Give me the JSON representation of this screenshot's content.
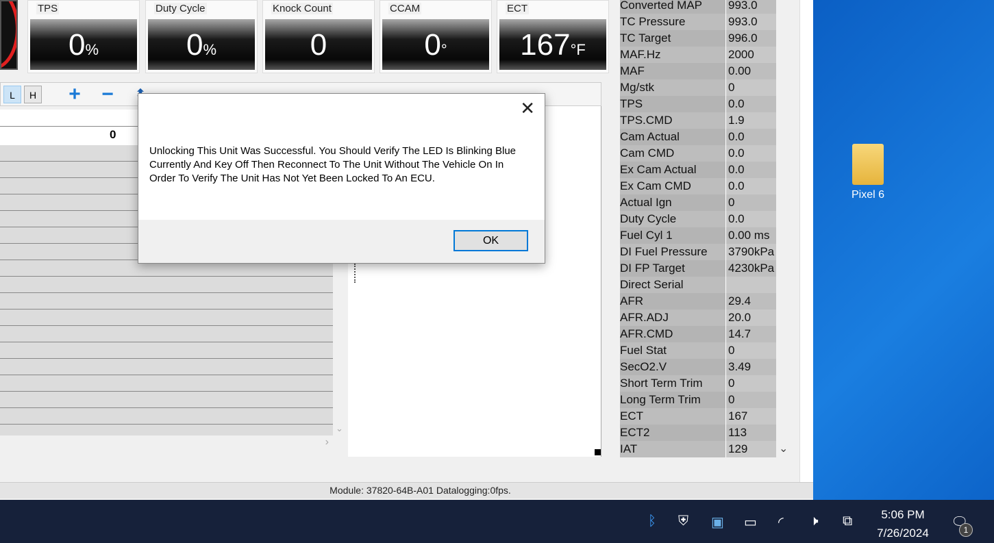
{
  "gauges": [
    {
      "label": "TPS",
      "value": "0",
      "unit": "%"
    },
    {
      "label": "Duty Cycle",
      "value": "0",
      "unit": "%"
    },
    {
      "label": "Knock Count",
      "value": "0",
      "unit": ""
    },
    {
      "label": "CCAM",
      "value": "0",
      "unit": "°"
    },
    {
      "label": "ECT",
      "value": "167",
      "unit": "°F"
    }
  ],
  "toolbar": {
    "l_label": "L",
    "h_label": "H"
  },
  "grid": {
    "header_value": "0"
  },
  "table": [
    [
      "Converted MAP",
      "993.0"
    ],
    [
      "TC Pressure",
      "993.0"
    ],
    [
      "TC Target",
      "996.0"
    ],
    [
      "MAF.Hz",
      "2000"
    ],
    [
      "MAF",
      "0.00"
    ],
    [
      "Mg/stk",
      "0"
    ],
    [
      "TPS",
      "0.0"
    ],
    [
      "TPS.CMD",
      "1.9"
    ],
    [
      "Cam Actual",
      "0.0"
    ],
    [
      "Cam CMD",
      "0.0"
    ],
    [
      "Ex Cam Actual",
      "0.0"
    ],
    [
      "Ex Cam CMD",
      "0.0"
    ],
    [
      "Actual Ign",
      "0"
    ],
    [
      "Duty Cycle",
      "0.0"
    ],
    [
      "Fuel Cyl 1",
      "0.00 ms"
    ],
    [
      "DI Fuel Pressure",
      "3790kPa"
    ],
    [
      "DI FP Target",
      "4230kPa"
    ],
    [
      "Direct Serial",
      ""
    ],
    [
      "AFR",
      "29.4"
    ],
    [
      "AFR.ADJ",
      "20.0"
    ],
    [
      "AFR.CMD",
      "14.7"
    ],
    [
      "Fuel Stat",
      "0"
    ],
    [
      "SecO2.V",
      "3.49"
    ],
    [
      "Short Term Trim",
      "0"
    ],
    [
      "Long Term Trim",
      "0"
    ],
    [
      "ECT",
      "167"
    ],
    [
      "ECT2",
      "113"
    ],
    [
      "IAT",
      "129"
    ]
  ],
  "status": "Module: 37820-64B-A01 Datalogging:0fps.",
  "dialog": {
    "message": "Unlocking This Unit Was Successful. You Should Verify The LED Is Blinking Blue Currently And Key Off Then Reconnect To The Unit Without The Vehicle On In Order To Verify The Unit Has Not Yet Been Locked To An ECU.",
    "ok_label": "OK"
  },
  "desktop": {
    "icon_label": "Pixel 6"
  },
  "taskbar": {
    "time": "5:06 PM",
    "date": "7/26/2024",
    "notification_count": "1"
  }
}
